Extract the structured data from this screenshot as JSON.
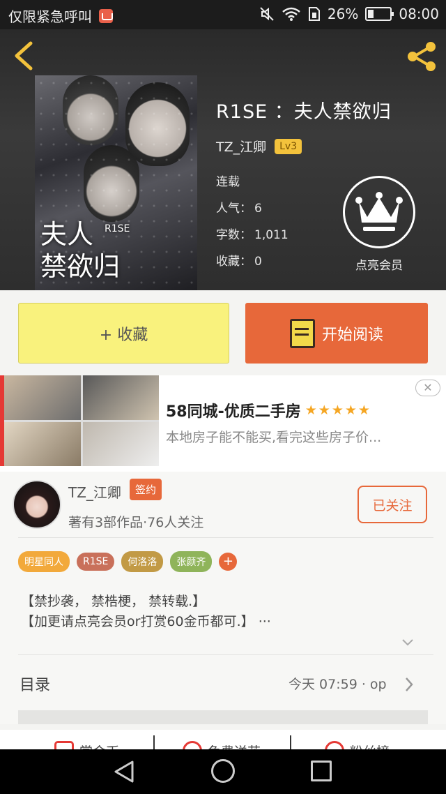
{
  "status_bar": {
    "carrier": "仅限紧急呼叫",
    "battery": "26%",
    "battery_level": 0.26,
    "time": "08:00"
  },
  "book": {
    "title": "R1SE ：夫人禁欲归",
    "author": "TZ_江卿",
    "level": "Lv3",
    "status": "连载",
    "popularity_label": "人气：",
    "popularity": "6",
    "words_label": "字数：",
    "words": "1,011",
    "favorites_label": "收藏：",
    "favorites": "0",
    "cover": {
      "title_line1": "夫人",
      "title_line2": "禁欲归",
      "brand": "R1SE"
    },
    "vip_label": "点亮会员"
  },
  "actions": {
    "collect": "+ 收藏",
    "read": "开始阅读"
  },
  "ad": {
    "title": "58同城-优质二手房",
    "stars": "★★★★★",
    "rating": 5,
    "description": "本地房子能不能买,看完这些房子价..."
  },
  "author": {
    "name": "TZ_江卿",
    "badge": "签约",
    "stats": "著有3部作品·76人关注",
    "follow": "已关注"
  },
  "tags": [
    {
      "label": "明星同人",
      "color": "#f2a93b"
    },
    {
      "label": "R1SE",
      "color": "#c9705a"
    },
    {
      "label": "何洛洛",
      "color": "#c29a45"
    },
    {
      "label": "张颜齐",
      "color": "#8fb45a"
    }
  ],
  "tag_add": "+",
  "description": {
    "line1": "【禁抄袭， 禁梏梗， 禁转载.】",
    "line2": "【加更请点亮会员or打赏60金币都可.】 ···"
  },
  "toc": {
    "label": "目录",
    "update": "今天 07:59 · op"
  },
  "bottom_tabs": [
    "赏金币",
    "免费送花",
    "粉丝榜"
  ]
}
